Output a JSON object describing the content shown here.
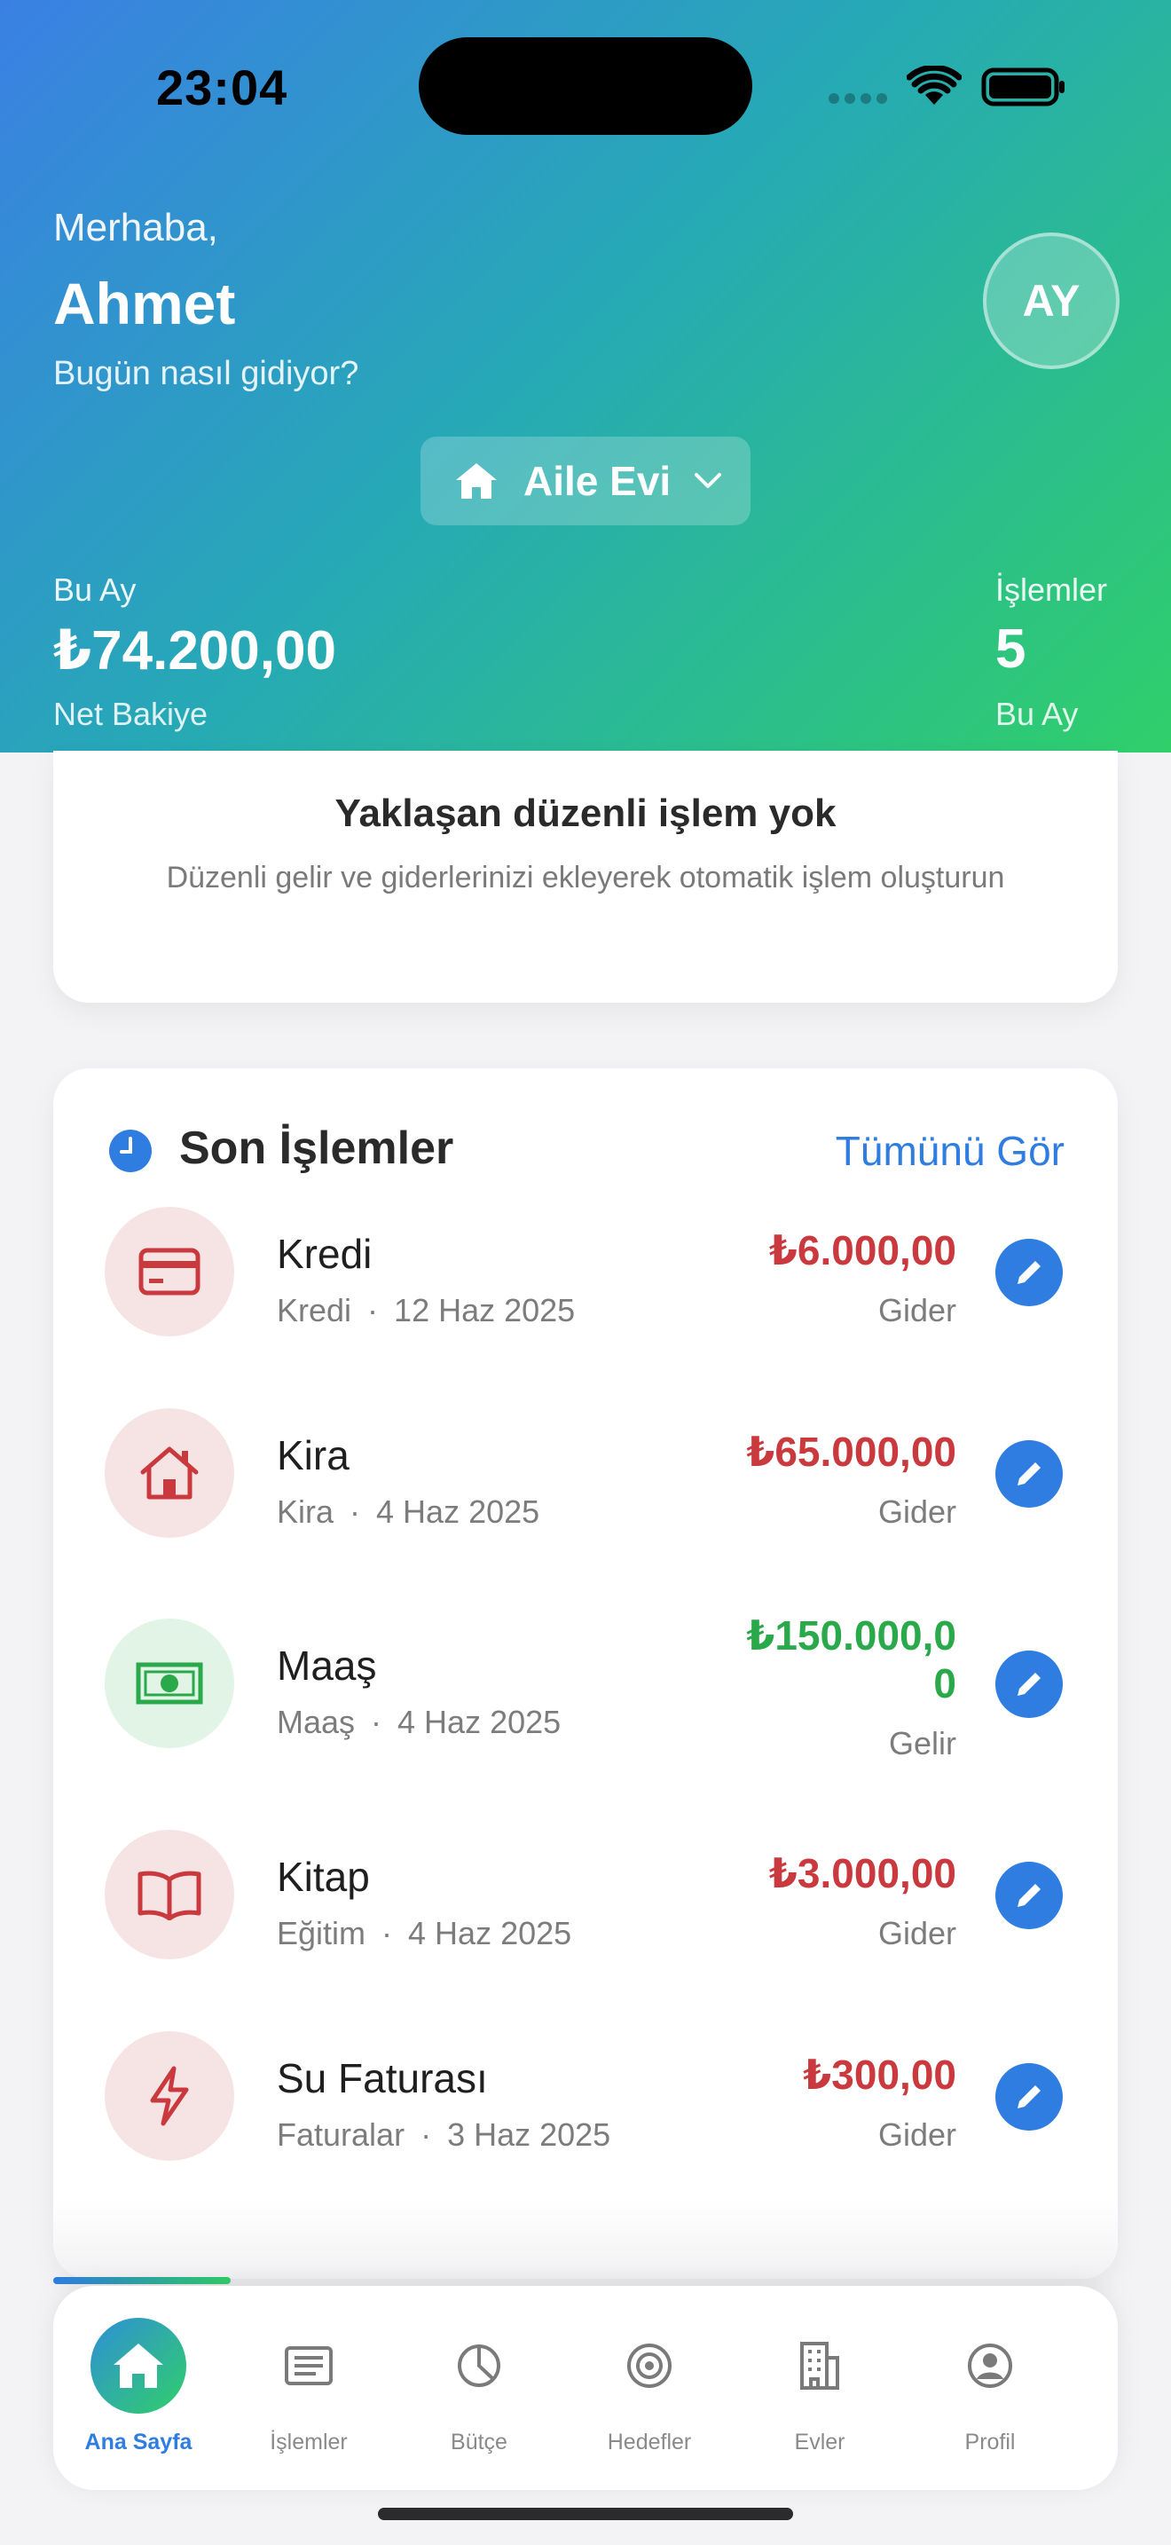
{
  "status_bar": {
    "time": "23:04"
  },
  "header": {
    "greeting": "Merhaba,",
    "user_name": "Ahmet",
    "subtitle": "Bugün nasıl gidiyor?",
    "avatar_initials": "AY",
    "home_selector": {
      "label": "Aile Evi",
      "icon": "house-icon"
    },
    "stats": {
      "month_label": "Bu Ay",
      "balance": "₺74.200,00",
      "balance_label": "Net Bakiye",
      "transactions_label": "İşlemler",
      "transactions_count": "5",
      "transactions_sub": "Bu Ay"
    }
  },
  "upcoming": {
    "title": "Yaklaşan düzenli işlem yok",
    "description": "Düzenli gelir ve giderlerinizi ekleyerek otomatik işlem oluşturun"
  },
  "recent": {
    "title": "Son İşlemler",
    "see_all": "Tümünü Gör",
    "items": [
      {
        "name": "Kredi",
        "category": "Kredi",
        "date": "12 Haz 2025",
        "amount": "₺6.000,00",
        "type": "Gider",
        "kind": "expense",
        "icon": "credit-card-icon"
      },
      {
        "name": "Kira",
        "category": "Kira",
        "date": "4 Haz 2025",
        "amount": "₺65.000,00",
        "type": "Gider",
        "kind": "expense",
        "icon": "house-icon"
      },
      {
        "name": "Maaş",
        "category": "Maaş",
        "date": "4 Haz 2025",
        "amount": "₺150.000,00",
        "type": "Gelir",
        "kind": "income",
        "icon": "banknote-icon"
      },
      {
        "name": "Kitap",
        "category": "Eğitim",
        "date": "4 Haz 2025",
        "amount": "₺3.000,00",
        "type": "Gider",
        "kind": "expense",
        "icon": "book-icon"
      },
      {
        "name": "Su Faturası",
        "category": "Faturalar",
        "date": "3 Haz 2025",
        "amount": "₺300,00",
        "type": "Gider",
        "kind": "expense",
        "icon": "lightning-icon"
      }
    ]
  },
  "nav": {
    "items": [
      {
        "label": "Ana Sayfa",
        "icon": "home-icon",
        "active": true
      },
      {
        "label": "İşlemler",
        "icon": "list-icon",
        "active": false
      },
      {
        "label": "Bütçe",
        "icon": "pie-chart-icon",
        "active": false
      },
      {
        "label": "Hedefler",
        "icon": "target-icon",
        "active": false
      },
      {
        "label": "Evler",
        "icon": "building-icon",
        "active": false
      },
      {
        "label": "Profil",
        "icon": "profile-icon",
        "active": false
      }
    ]
  },
  "colors": {
    "accent": "#2f7de1",
    "expense": "#c9393d",
    "income": "#2aa94b",
    "gradient_start": "#3a80e4",
    "gradient_end": "#30cf6a"
  }
}
